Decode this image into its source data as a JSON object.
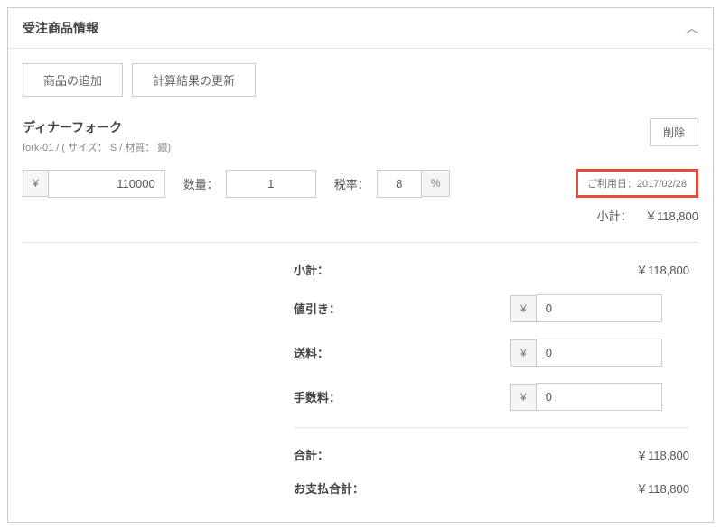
{
  "header": {
    "title": "受注商品情報"
  },
  "buttons": {
    "add_product": "商品の追加",
    "recalculate": "計算結果の更新",
    "delete": "削除"
  },
  "product": {
    "name": "ディナーフォーク",
    "code": "fork-01 / ( サイズ： S / 材質： 銀)",
    "currency": "¥",
    "price": "110000",
    "qty_label": "数量：",
    "qty": "1",
    "tax_label": "税率：",
    "tax": "8",
    "percent": "%",
    "usage_date": "ご利用日：2017/02/28",
    "subtotal_label": "小計：",
    "subtotal_value": "￥118,800"
  },
  "summary": {
    "subtotal_label": "小計：",
    "subtotal_value": "￥118,800",
    "discount_label": "値引き：",
    "discount_value": "0",
    "shipping_label": "送料：",
    "shipping_value": "0",
    "fee_label": "手数料：",
    "fee_value": "0",
    "total_label": "合計：",
    "total_value": "￥118,800",
    "payment_label": "お支払合計：",
    "payment_value": "￥118,800"
  }
}
